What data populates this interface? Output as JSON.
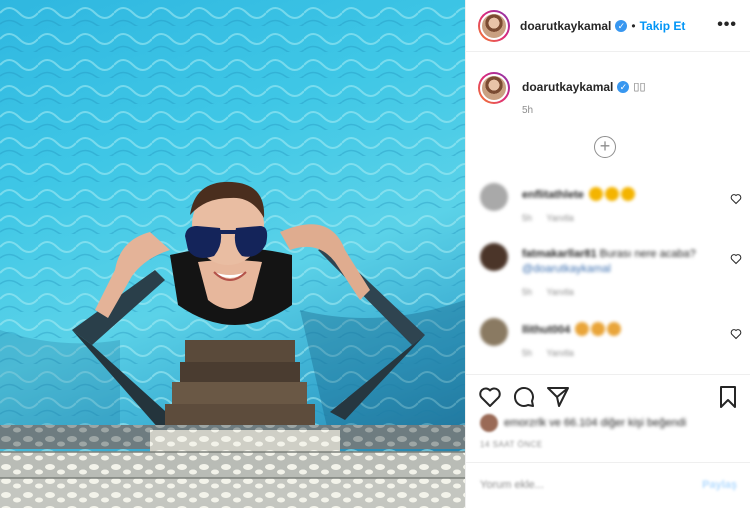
{
  "post": {
    "image_alt": "Woman in sunglasses climbing a ladder out of turquoise sea water onto a wooden pier"
  },
  "header": {
    "username": "doarutkaykamal",
    "verified_glyph": "✓",
    "separator": "•",
    "follow_label": "Takip Et",
    "more_label": "•••"
  },
  "caption": {
    "username": "doarutkaykamal",
    "verified_glyph": "✓",
    "text": "▯▯",
    "time": "5h"
  },
  "load_more_label": "+",
  "comments": [
    {
      "username": "enflitathlete",
      "text": "",
      "meta_time": "5h",
      "meta_reply": "Yanıtla",
      "emoji_count": 3
    },
    {
      "username": "fatmakarllar81",
      "text": "Burası nere acaba?",
      "mention": "@doarutkaykamal",
      "meta_time": "5h",
      "meta_reply": "Yanıtla",
      "emoji_count": 0
    },
    {
      "username": "llithut004",
      "text": "",
      "meta_time": "5h",
      "meta_reply": "Yanıtla",
      "emoji_count": 3
    }
  ],
  "likes": {
    "text": "emorzrlk ve 66.104 diğer kişi beğendi"
  },
  "date": "14 SAAT ÖNCE",
  "add_comment": {
    "placeholder": "Yorum ekle...",
    "post_label": "Paylaş"
  },
  "icons": [
    "heart-icon",
    "comment-icon",
    "share-icon",
    "bookmark-icon",
    "more-icon",
    "verified-icon",
    "plus-circle-icon"
  ],
  "colors": {
    "accent": "#0095f6",
    "verified": "#3897f0",
    "border": "#efefef",
    "muted": "#8e8e8e"
  }
}
